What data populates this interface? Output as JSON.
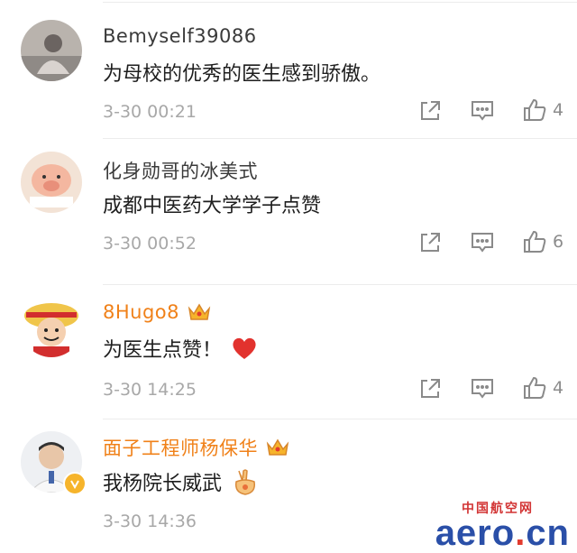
{
  "comments": [
    {
      "name": "Bemyself39086",
      "text": "为母校的优秀的医生感到骄傲。",
      "time": "3-30 00:21",
      "likes": "4",
      "vip": false,
      "emoji": ""
    },
    {
      "name": "化身勋哥的冰美式",
      "text": "成都中医药大学学子点赞",
      "time": "3-30 00:52",
      "likes": "6",
      "vip": false,
      "emoji": ""
    },
    {
      "name": "8Hugo8",
      "text": "为医生点赞！",
      "time": "3-30 14:25",
      "likes": "4",
      "vip": true,
      "emoji": "red-heart"
    },
    {
      "name": "面子工程师杨保华",
      "text": "我杨院长威武",
      "time": "3-30 14:36",
      "likes": "",
      "vip": true,
      "verified": true,
      "emoji": "victory-hand"
    }
  ],
  "icons": {
    "share": "share-icon",
    "comment": "comment-icon",
    "like": "thumbs-up-icon",
    "vip": "crown-icon"
  },
  "colors": {
    "vip_name": "#f08119",
    "meta": "#a8a8a8",
    "text": "#1e1e1e"
  },
  "watermark": {
    "top": "中国航空网",
    "main_left": "aero",
    "main_dot": ".",
    "main_right": "cn"
  }
}
